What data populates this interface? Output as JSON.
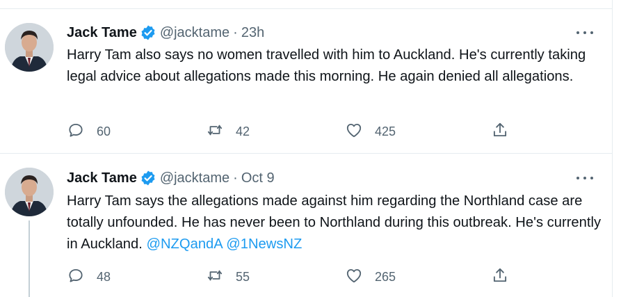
{
  "tweets": [
    {
      "author_name": "Jack Tame",
      "handle": "@jacktame",
      "separator": "·",
      "time": "23h",
      "text_plain": "Harry Tam also says no women travelled with him to Auckland. He's currently taking legal advice about allegations made this morning. He again denied all allegations.",
      "text_mentions": [
        "",
        ""
      ],
      "replies": "60",
      "retweets": "42",
      "likes": "425"
    },
    {
      "author_name": "Jack Tame",
      "handle": "@jacktame",
      "separator": "·",
      "time": "Oct 9",
      "text_plain": "Harry Tam says the allegations made against him regarding the Northland case are totally unfounded. He has never been to Northland during this outbreak. He's currently in Auckland.",
      "text_mentions": [
        "@NZQandA",
        "@1NewsNZ"
      ],
      "replies": "48",
      "retweets": "55",
      "likes": "265"
    }
  ],
  "colors": {
    "accent": "#1d9bf0",
    "text": "#0f1419",
    "secondary": "#536471",
    "border": "#e6ecf0"
  },
  "icons": [
    "verified-badge-icon",
    "more-icon",
    "reply-icon",
    "retweet-icon",
    "like-icon",
    "share-icon"
  ]
}
